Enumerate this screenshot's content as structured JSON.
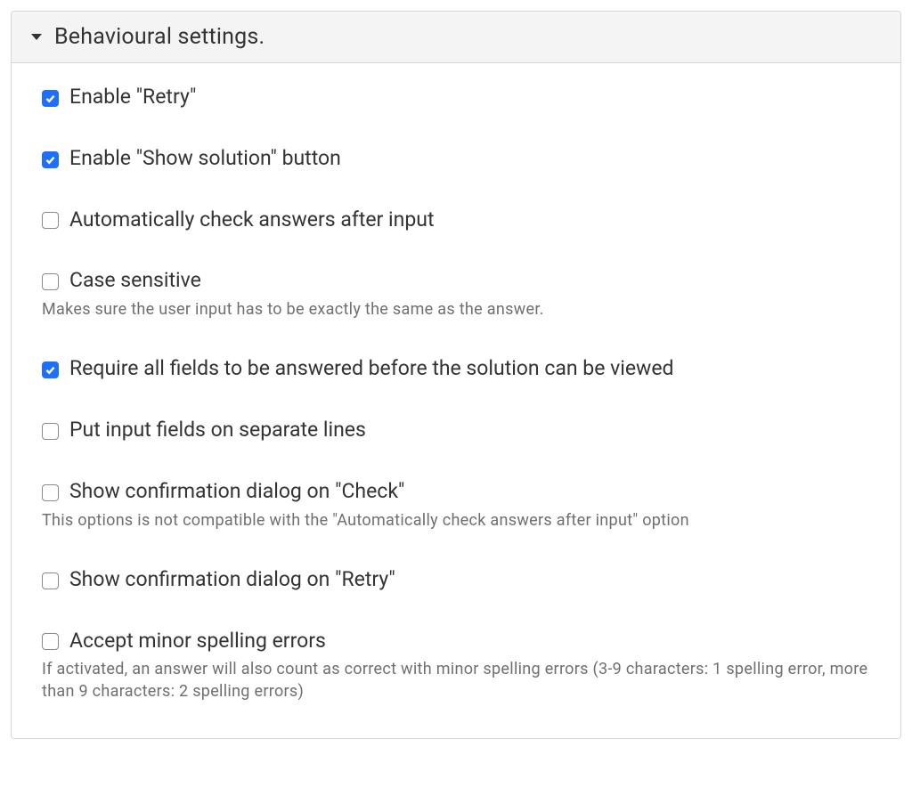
{
  "panel": {
    "title": "Behavioural settings.",
    "expanded": true
  },
  "fields": [
    {
      "key": "enable_retry",
      "label": "Enable \"Retry\"",
      "checked": true,
      "description": ""
    },
    {
      "key": "enable_show_solution",
      "label": "Enable \"Show solution\" button",
      "checked": true,
      "description": ""
    },
    {
      "key": "auto_check",
      "label": "Automatically check answers after input",
      "checked": false,
      "description": ""
    },
    {
      "key": "case_sensitive",
      "label": "Case sensitive",
      "checked": false,
      "description": "Makes sure the user input has to be exactly the same as the answer."
    },
    {
      "key": "require_all_fields",
      "label": "Require all fields to be answered before the solution can be viewed",
      "checked": true,
      "description": ""
    },
    {
      "key": "separate_lines",
      "label": "Put input fields on separate lines",
      "checked": false,
      "description": ""
    },
    {
      "key": "confirm_check",
      "label": "Show confirmation dialog on \"Check\"",
      "checked": false,
      "description": "This options is not compatible with the \"Automatically check answers after input\" option"
    },
    {
      "key": "confirm_retry",
      "label": "Show confirmation dialog on \"Retry\"",
      "checked": false,
      "description": ""
    },
    {
      "key": "accept_spelling",
      "label": "Accept minor spelling errors",
      "checked": false,
      "description": "If activated, an answer will also count as correct with minor spelling errors (3-9 characters: 1 spelling error, more than 9 characters: 2 spelling errors)"
    }
  ]
}
